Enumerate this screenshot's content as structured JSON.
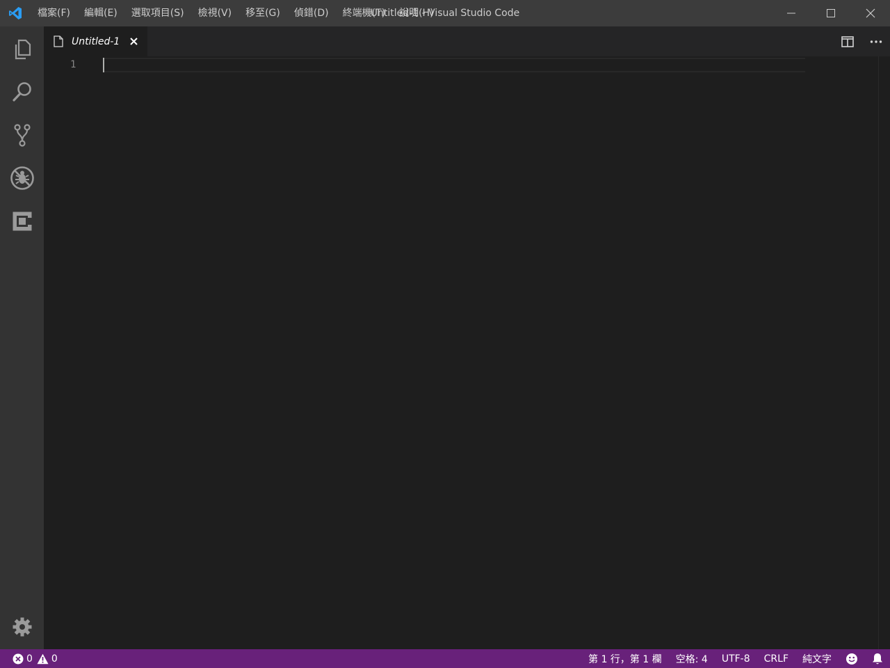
{
  "titlebar": {
    "menu": [
      "檔案(F)",
      "編輯(E)",
      "選取項目(S)",
      "檢視(V)",
      "移至(G)",
      "偵錯(D)",
      "終端機(T)",
      "說明(H)"
    ],
    "window_title": "Untitled-1 - Visual Studio Code"
  },
  "activitybar": {
    "items": [
      "explorer-icon",
      "search-icon",
      "source-control-icon",
      "debug-icon",
      "extensions-icon"
    ],
    "bottom": "gear-icon"
  },
  "editor": {
    "tab": {
      "label": "Untitled-1",
      "close": "×"
    },
    "line_numbers": [
      "1"
    ],
    "actions": [
      "split-editor-icon",
      "more-actions-icon"
    ]
  },
  "statusbar": {
    "errors": "0",
    "warnings": "0",
    "position": "第 1 行，第 1 欄",
    "indent": "空格: 4",
    "encoding": "UTF-8",
    "eol": "CRLF",
    "language": "純文字"
  },
  "colors": {
    "titlebar": "#3c3c3c",
    "activitybar": "#333333",
    "editor_bg": "#1e1e1e",
    "tabbar": "#252526",
    "statusbar": "#68217a",
    "vscode_blue": "#0065a9"
  }
}
